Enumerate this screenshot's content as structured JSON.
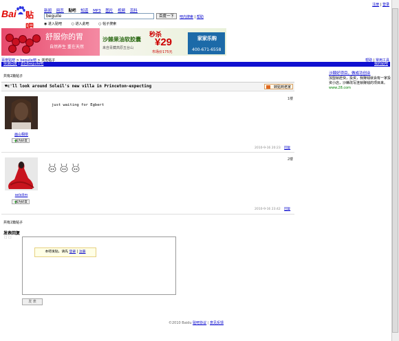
{
  "header": {
    "top_links": [
      "注册",
      "登录"
    ],
    "nav": [
      "新闻",
      "网页",
      "贴吧",
      "知道",
      "MP3",
      "图片",
      "视频",
      "百科"
    ],
    "nav_current": "贴吧",
    "search_value": "beguile",
    "search_button": "百度一下",
    "search_links": [
      "吧内搜索",
      "帮助"
    ],
    "radios": [
      "进入贴吧",
      "进入此吧",
      "帖子搜索"
    ]
  },
  "banner": {
    "left_title": "舒服你的胃",
    "left_sub": "自然养生 重在天然",
    "right_title": "沙棘果油软胶囊",
    "right_sub": "来自青藏高原五台山",
    "sale": "秒杀",
    "price": "¥29",
    "original": "市场价175元",
    "brand": "家家乐购",
    "phone": "400-671-6558"
  },
  "crumb": {
    "items": [
      "百度贴吧",
      "beguile吧",
      "浏览帖子"
    ],
    "right": [
      "帮助",
      "常用工具"
    ],
    "bar_left": [
      "快速回复",
      "返回beguile吧"
    ],
    "bar_right": "我的贴吧"
  },
  "thread": {
    "count_top": "共有2篇帖子",
    "title": "♥c'll look around Soleil's new villa in Princeton~expecting",
    "share": "转贴到老家",
    "posts": [
      {
        "floor": "1楼",
        "user": "画山相依",
        "text": "just waiting for Egbert",
        "time": "2010-9-16 20:23",
        "reply": "回复",
        "add": "加为好友"
      },
      {
        "floor": "2楼",
        "user": "selsilim",
        "text": "",
        "time": "2010-9-16 23:42",
        "reply": "回复",
        "add": "加为好友"
      }
    ],
    "count_bottom": "共有2篇帖子"
  },
  "reply": {
    "heading": "发表回复",
    "tip": "本吧发贴，请先",
    "tip_links": [
      "登录",
      "注册"
    ],
    "submit": "发 表"
  },
  "side": {
    "title": "沙棘好项目，做成功创业",
    "body": "加盟就赶快，投资，我赚钱就会有一家投资小店，沙棘改写连锁赚钱的项目来。",
    "url": "www.28.com"
  },
  "footer": {
    "copyright": "©2010 Baidu",
    "links": [
      "贴吧协议",
      "意见反馈"
    ]
  }
}
